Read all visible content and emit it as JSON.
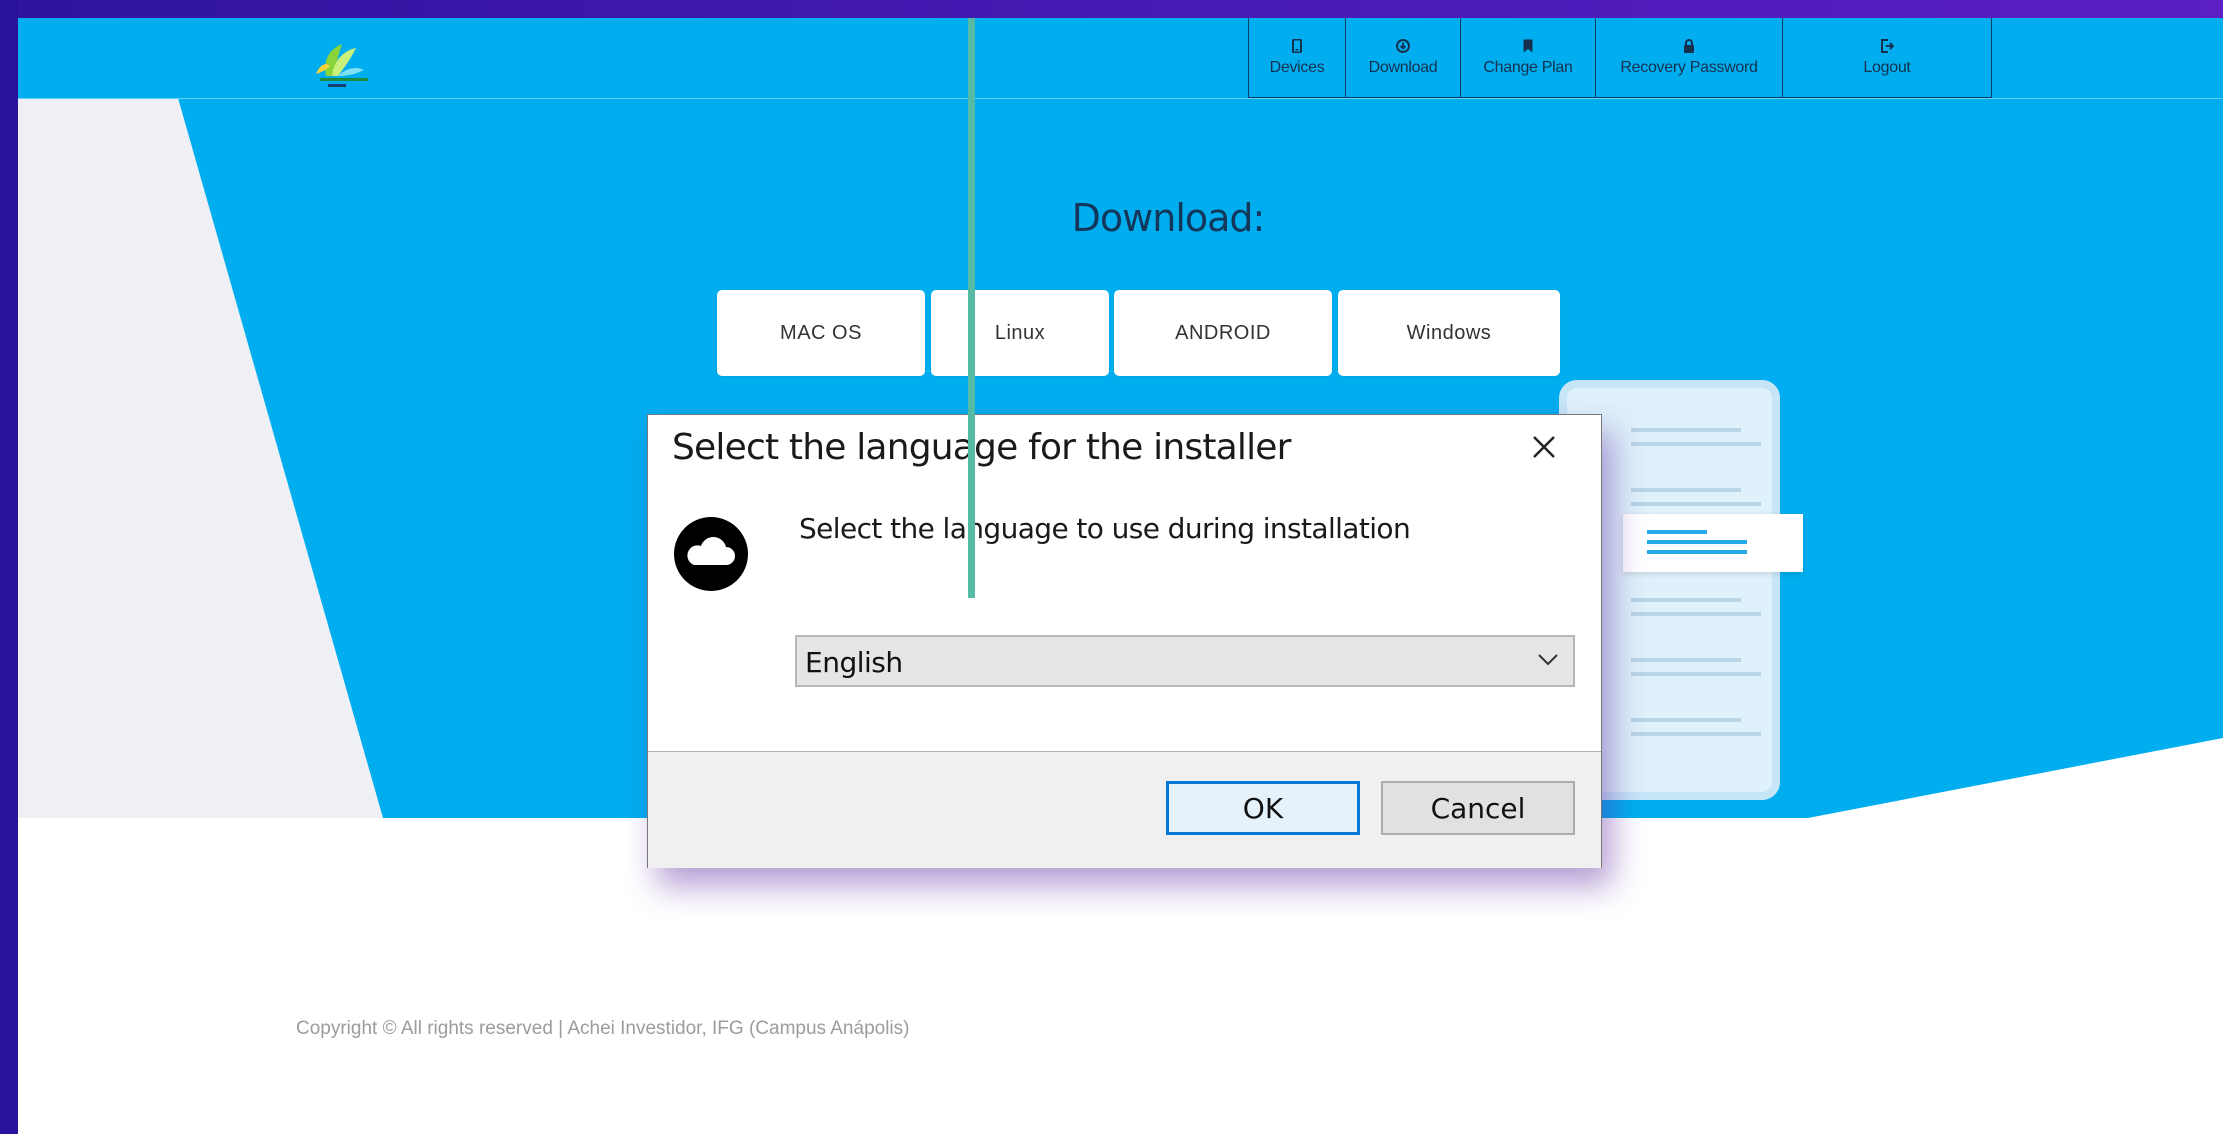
{
  "nav": {
    "items": [
      {
        "label": "Devices",
        "icon": "phone-icon"
      },
      {
        "label": "Download",
        "icon": "download-icon"
      },
      {
        "label": "Change Plan",
        "icon": "bookmark-icon"
      },
      {
        "label": "Recovery Password",
        "icon": "lock-icon"
      },
      {
        "label": "Logout",
        "icon": "logout-icon"
      }
    ]
  },
  "download": {
    "title": "Download:",
    "options": [
      "MAC OS",
      "Linux",
      "ANDROID",
      "Windows"
    ]
  },
  "dialog": {
    "title": "Select the language for the installer",
    "message": "Select the language to use during installation",
    "language": "English",
    "ok_label": "OK",
    "cancel_label": "Cancel"
  },
  "footer": {
    "copyright": "Copyright © All rights reserved | Achei Investidor, IFG (Campus Anápolis)"
  },
  "colors": {
    "hero": "#00aeef",
    "dialog_accent": "#0078d7",
    "frame": "#3a14a6"
  }
}
